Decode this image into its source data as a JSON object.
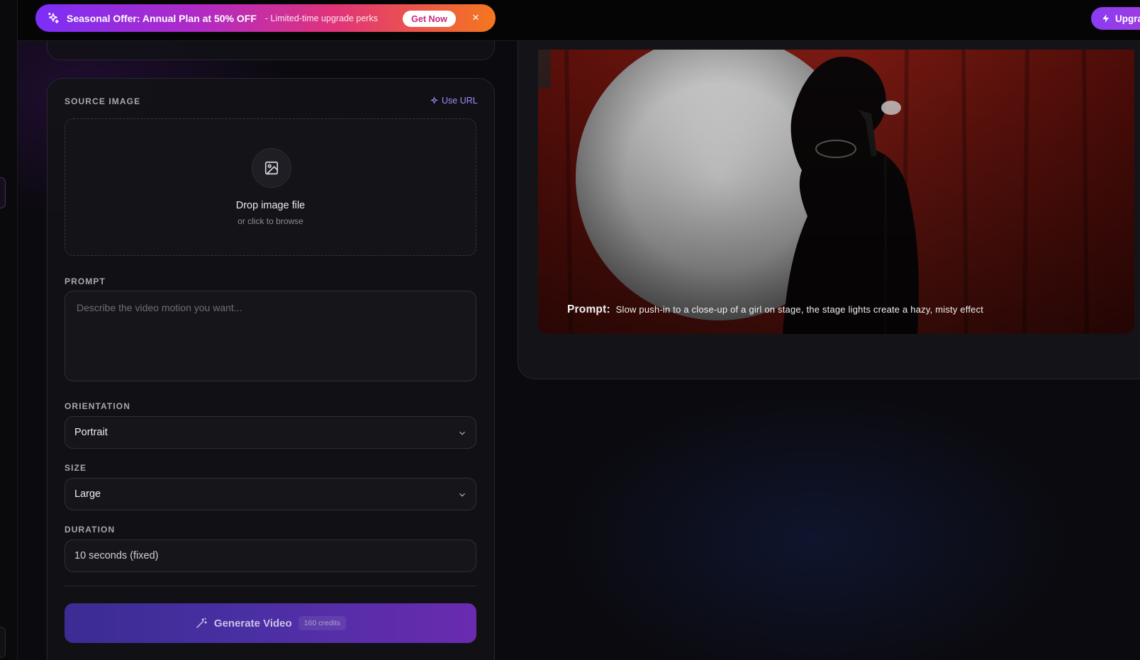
{
  "promo": {
    "title": "Seasonal Offer: Annual Plan at 50% OFF",
    "subtitle": "- Limited-time upgrade perks",
    "cta": "Get Now",
    "close": "×"
  },
  "header": {
    "upgrade_label": "Upgra"
  },
  "form": {
    "source_image": {
      "label": "SOURCE IMAGE",
      "use_url": "Use URL",
      "drop_title": "Drop image file",
      "drop_sub": "or click to browse"
    },
    "prompt": {
      "label": "PROMPT",
      "value": "",
      "placeholder": "Describe the video motion you want..."
    },
    "orientation": {
      "label": "ORIENTATION",
      "value": "Portrait"
    },
    "size": {
      "label": "SIZE",
      "value": "Large"
    },
    "duration": {
      "label": "DURATION",
      "value": "10 seconds (fixed)"
    },
    "generate": {
      "label": "Generate Video",
      "credits": "160 credits"
    }
  },
  "preview": {
    "prompt_label": "Prompt:",
    "prompt_text": "Slow push-in to a close-up of a girl on stage, the stage lights create a hazy, misty effect"
  },
  "colors": {
    "accent": "#8b3cf2",
    "promo_start": "#7b2ff7",
    "promo_end": "#f5771e",
    "link": "#9b8cff"
  }
}
